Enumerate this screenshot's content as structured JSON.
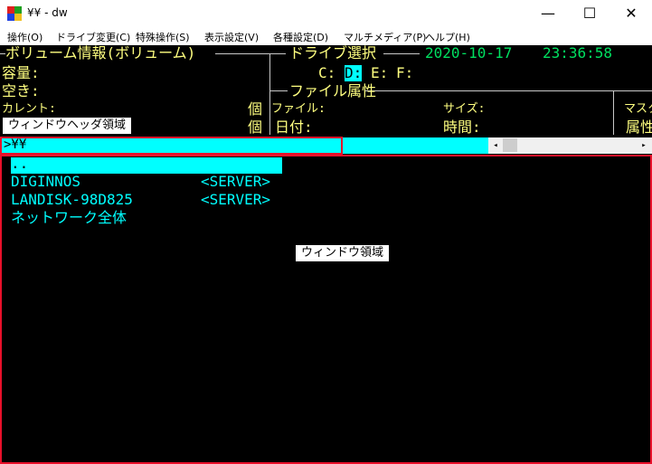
{
  "window": {
    "title": "¥¥ - dw",
    "min_glyph": "—",
    "max_glyph": "☐",
    "close_glyph": "✕"
  },
  "menu": [
    "操作(O)",
    "ドライブ変更(C)",
    "特殊操作(S)",
    "表示設定(V)",
    "各種設定(D)",
    "マルチメディア(P)",
    "ヘルプ(H)"
  ],
  "volume_panel": {
    "title": "ボリューム情報(ボリューム)",
    "capacity_label": "容量:",
    "free_label": "空き:",
    "current_label": "カレント:",
    "count_unit_1": "個",
    "count_unit_2": "個"
  },
  "drive_select": {
    "title": "ドライブ選択",
    "date": "2020-10-17",
    "time": "23:36:58",
    "drive_c": "C:",
    "drive_d": "D:",
    "drive_e": "E:",
    "drive_f": "F:",
    "selected": "D:"
  },
  "file_attr": {
    "title": "ファイル属性",
    "file_label": "ファイル:",
    "size_label": "サイズ:",
    "mask_label": "マスク",
    "date_label": "日付:",
    "time_label": "時間:",
    "attr_label": "属性"
  },
  "path_bar": {
    "path": ">¥¥",
    "scroll_left": "◂",
    "scroll_right": "▸"
  },
  "file_list": [
    {
      "name": "..",
      "type": "",
      "selected": true
    },
    {
      "name": "DIGINNOS",
      "type": "<SERVER>",
      "selected": false
    },
    {
      "name": "LANDISK-98D825",
      "type": "<SERVER>",
      "selected": false
    },
    {
      "name": "ネットワーク全体",
      "type": "",
      "selected": false
    }
  ],
  "annotations": {
    "header_area": "ウィンドウヘッダ領域",
    "window_area": "ウィンドウ領域"
  },
  "colors": {
    "label": "#ffff80",
    "value": "#00ffff",
    "clock": "#00e060",
    "highlight": "#00ffff",
    "callout_border": "#e8102a"
  }
}
